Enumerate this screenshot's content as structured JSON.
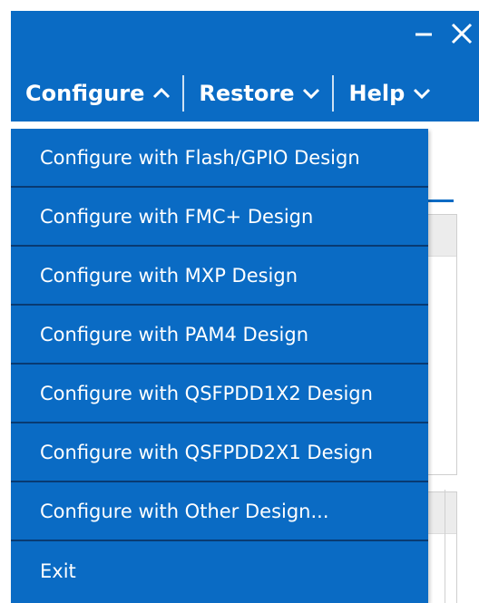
{
  "menubar": {
    "menus": [
      {
        "label": "Configure",
        "expanded": true
      },
      {
        "label": "Restore",
        "expanded": false
      },
      {
        "label": "Help",
        "expanded": false
      }
    ]
  },
  "window_controls": {
    "minimize_icon": "minimize-icon",
    "close_icon": "close-icon"
  },
  "dropdown": {
    "items": [
      {
        "label": "Configure with Flash/GPIO Design"
      },
      {
        "label": "Configure with FMC+ Design"
      },
      {
        "label": "Configure with MXP Design"
      },
      {
        "label": "Configure with PAM4 Design"
      },
      {
        "label": "Configure with QSFPDD1X2 Design"
      },
      {
        "label": "Configure with QSFPDD2X1 Design"
      },
      {
        "label": "Configure with Other Design..."
      },
      {
        "label": "Exit"
      }
    ]
  },
  "colors": {
    "accent": "#0a6bc4",
    "divider": "#083a72",
    "text": "#ffffff"
  }
}
